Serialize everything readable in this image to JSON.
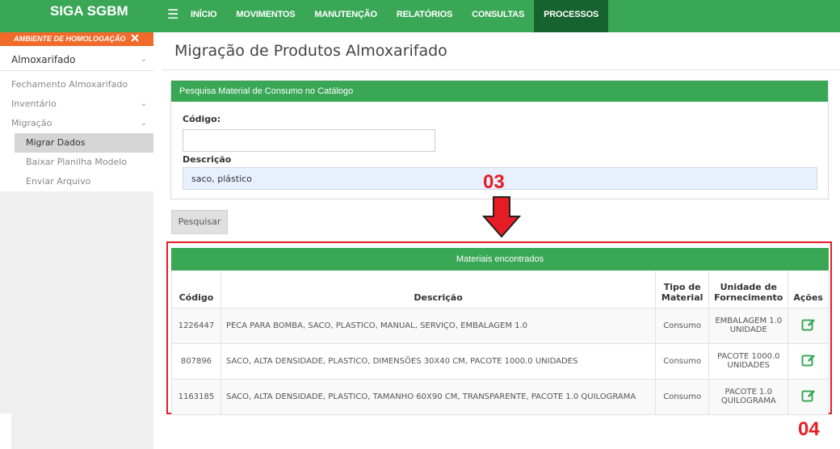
{
  "app": {
    "title": "SIGA SGBM"
  },
  "nav": {
    "items": [
      "INÍCIO",
      "MOVIMENTOS",
      "MANUTENÇÃO",
      "RELATÓRIOS",
      "CONSULTAS",
      "PROCESSOS"
    ],
    "active_index": 5
  },
  "environment": {
    "label": "AMBIENTE DE HOMOLOGAÇÃO"
  },
  "sidebar": {
    "section": "Almoxarifado",
    "items": [
      "Fechamento Almoxarifado",
      "Inventário",
      "Migração"
    ],
    "sub_items": [
      "Migrar Dados",
      "Baixar Planilha Modelo",
      "Enviar Arquivo"
    ]
  },
  "page": {
    "title": "Migração de Produtos Almoxarifado"
  },
  "search": {
    "panel_title": "Pesquisa Material de Consumo no Catálogo",
    "code_label": "Código:",
    "code_value": "",
    "desc_label": "Descrição",
    "desc_value": "saco, plástico",
    "button_label": "Pesquisar"
  },
  "annotations": {
    "step3": "03",
    "step4": "04"
  },
  "results": {
    "title": "Materiais encontrados",
    "headers": {
      "code": "Código",
      "desc": "Descrição",
      "tipo": "Tipo de Material",
      "uni": "Unidade de Fornecimento",
      "acoes": "Ações"
    },
    "rows": [
      {
        "code": "1226447",
        "desc": "PECA PARA BOMBA, SACO, PLASTICO, MANUAL, SERVIÇO, EMBALAGEM 1.0",
        "tipo": "Consumo",
        "uni": "EMBALAGEM 1.0 UNIDADE"
      },
      {
        "code": "807896",
        "desc": "SACO, ALTA DENSIDADE, PLASTICO, DIMENSÕES 30X40 CM, PACOTE 1000.0 UNIDADES",
        "tipo": "Consumo",
        "uni": "PACOTE 1000.0 UNIDADES"
      },
      {
        "code": "1163185",
        "desc": "SACO, ALTA DENSIDADE, PLASTICO, TAMANHO 60X90 CM, TRANSPARENTE, PACOTE 1.0 QUILOGRAMA",
        "tipo": "Consumo",
        "uni": "PACOTE 1.0 QUILOGRAMA"
      }
    ]
  },
  "colors": {
    "primary": "#3aa757",
    "active_nav": "#16632f",
    "environment": "#f06a2a",
    "annotation": "#e51c23"
  },
  "icons": {
    "edit": "edit-pencil-icon",
    "menu": "hamburger-icon"
  }
}
